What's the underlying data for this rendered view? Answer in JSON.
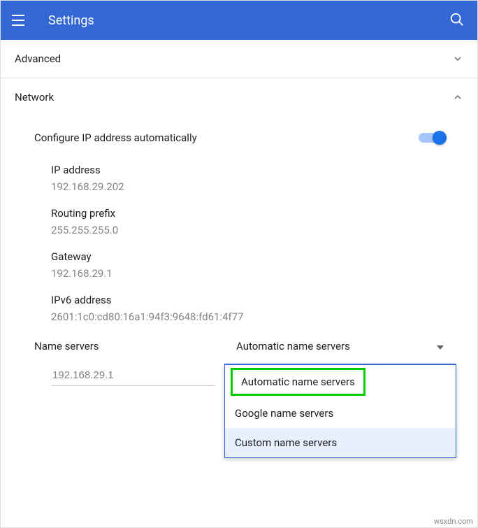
{
  "header": {
    "title": "Settings"
  },
  "sections": {
    "advanced": {
      "label": "Advanced",
      "expanded": false
    },
    "network": {
      "label": "Network",
      "expanded": true
    }
  },
  "network": {
    "auto_ip_label": "Configure IP address automatically",
    "auto_ip_on": true,
    "fields": {
      "ip_label": "IP address",
      "ip_value": "192.168.29.202",
      "prefix_label": "Routing prefix",
      "prefix_value": "255.255.255.0",
      "gateway_label": "Gateway",
      "gateway_value": "192.168.29.1",
      "ipv6_label": "IPv6 address",
      "ipv6_value": "2601:1c0:cd80:16a1:94f3:9648:fd61:4f77"
    },
    "name_servers": {
      "label": "Name servers",
      "selected": "Automatic name servers",
      "options": {
        "auto": "Automatic name servers",
        "google": "Google name servers",
        "custom": "Custom name servers"
      },
      "dns_value": "192.168.29.1"
    }
  },
  "watermark": "wsxdn.com"
}
